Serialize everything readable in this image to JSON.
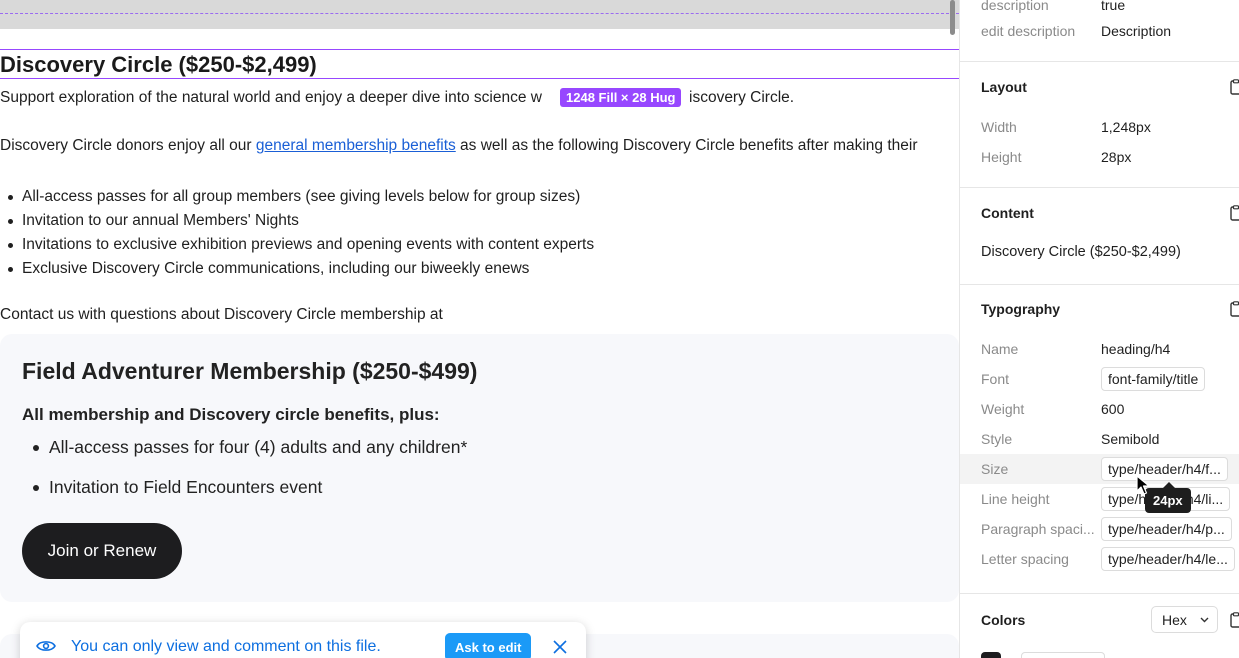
{
  "canvas": {
    "heading": "Discovery Circle ($250-$2,499)",
    "dimension_badge": "1248 Fill × 28 Hug",
    "intro_before": "Support exploration of the natural world and enjoy a deeper dive into science w",
    "intro_after": "iscovery Circle.",
    "benefits_before": "Discovery Circle donors enjoy all our ",
    "benefits_link": "general membership benefits",
    "benefits_after": " as well as the following Discovery Circle benefits after making their",
    "bullets": [
      "All-access passes for all group members (see giving levels below for group sizes)",
      "Invitation to our annual Members' Nights",
      "Invitations to exclusive exhibition previews and opening events with content experts",
      "Exclusive Discovery Circle communications, including our biweekly enews"
    ],
    "contact": "Contact us with questions about Discovery Circle membership at",
    "card": {
      "title": "Field Adventurer Membership ($250-$499)",
      "subtitle": "All membership and Discovery circle benefits, plus:",
      "items": [
        "All-access passes for four (4) adults and any children*",
        "Invitation to Field Encounters event"
      ],
      "button": "Join or Renew"
    },
    "toast": {
      "message": "You can only view and comment on this file.",
      "action": "Ask to edit"
    }
  },
  "inspector": {
    "top_rows": [
      {
        "key": "description",
        "value": "true"
      },
      {
        "key": "edit description",
        "value": "Description"
      }
    ],
    "layout": {
      "title": "Layout",
      "width_label": "Width",
      "width_value": "1,248px",
      "height_label": "Height",
      "height_value": "28px"
    },
    "content": {
      "title": "Content",
      "value": "Discovery Circle ($250-$2,499)"
    },
    "typography": {
      "title": "Typography",
      "rows": [
        {
          "key": "Name",
          "value": "heading/h4"
        },
        {
          "key": "Font",
          "value": "font-family/title"
        },
        {
          "key": "Weight",
          "value": "600"
        },
        {
          "key": "Style",
          "value": "Semibold"
        },
        {
          "key": "Size",
          "value": "type/header/h4/f..."
        },
        {
          "key": "Line height",
          "value": "type/header/h4/li..."
        },
        {
          "key": "Paragraph spaci...",
          "value": "type/header/h4/p..."
        },
        {
          "key": "Letter spacing",
          "value": "type/header/h4/le..."
        }
      ],
      "tooltip": "24px"
    },
    "colors": {
      "title": "Colors",
      "format": "Hex",
      "swatch_color": "#1d1d1f"
    }
  },
  "colors": {
    "selection": "#9747ff",
    "link": "#1a5fd6",
    "toast_text": "#0d6fe0",
    "ask_button": "#1b9af7",
    "button_dark": "#1d1d1f"
  }
}
